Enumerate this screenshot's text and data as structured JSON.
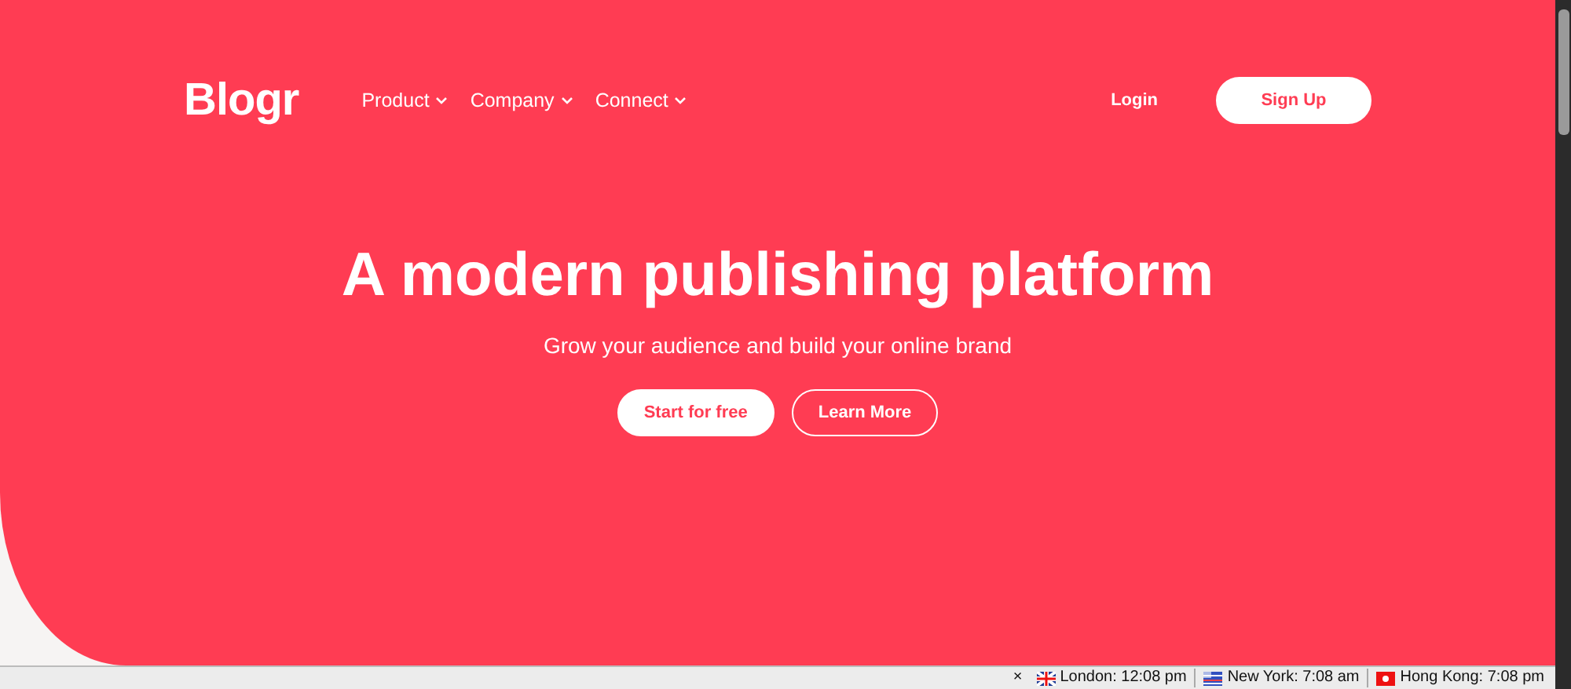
{
  "header": {
    "logo": "Blogr",
    "menu": [
      {
        "label": "Product"
      },
      {
        "label": "Company"
      },
      {
        "label": "Connect"
      }
    ],
    "login": "Login",
    "signup": "Sign Up"
  },
  "hero": {
    "title": "A modern publishing platform",
    "subtitle": "Grow your audience and build your online brand",
    "buttons": [
      {
        "label": "Start for free",
        "kind": "filled"
      },
      {
        "label": "Learn More",
        "kind": "outline"
      }
    ]
  },
  "status_bar": {
    "close": "×",
    "clocks": [
      {
        "kind": "uk",
        "label": "London: 12:08 pm"
      },
      {
        "kind": "us",
        "label": "New York: 7:08 am"
      },
      {
        "kind": "hk",
        "label": "Hong Kong: 7:08 pm"
      }
    ]
  }
}
